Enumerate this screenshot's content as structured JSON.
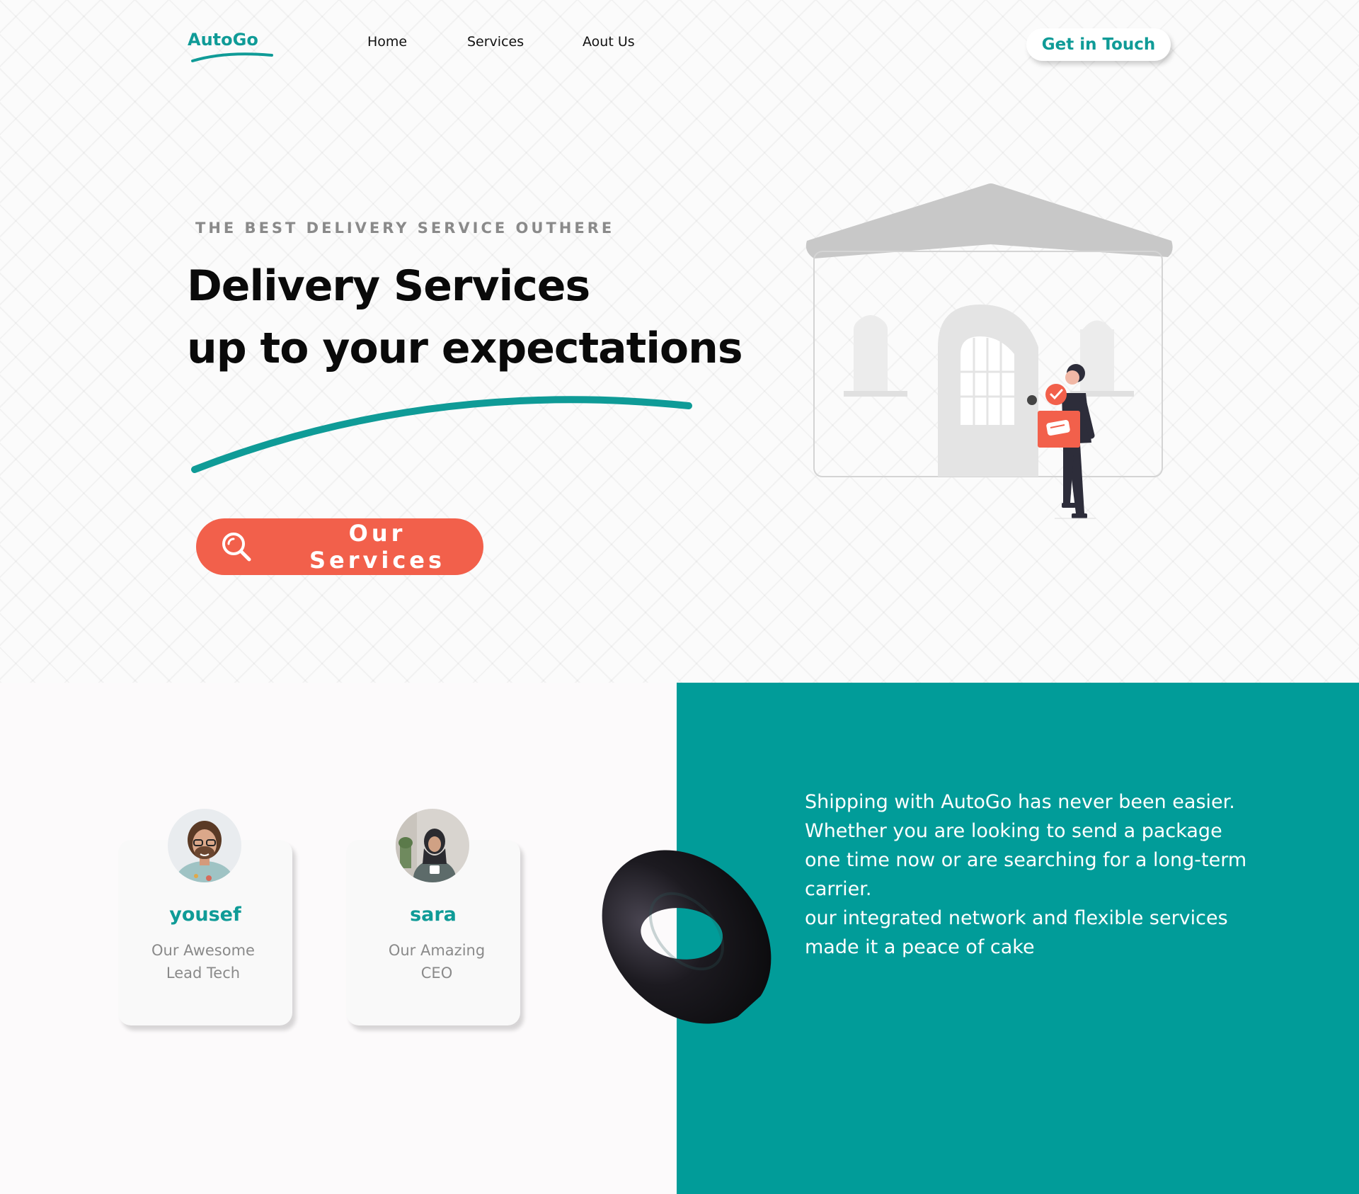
{
  "brand": {
    "name": "AutoGo",
    "accent": "#0f9b97",
    "cta_color": "#f2604b"
  },
  "nav": {
    "home": "Home",
    "services": "Services",
    "about": "Aout Us"
  },
  "header": {
    "cta_label": "Get in Touch"
  },
  "hero": {
    "tagline": "THE BEST DELIVERY SERVICE OUTHERE",
    "headline_line1": "Delivery Services",
    "headline_line2": "up to your expectations",
    "button_label": "Our Services",
    "button_icon": "search-icon"
  },
  "team": [
    {
      "name": "yousef",
      "role_line1": "Our Awesome",
      "role_line2": "Lead Tech"
    },
    {
      "name": "sara",
      "role_line1": "Our Amazing",
      "role_line2": "CEO"
    }
  ],
  "about": {
    "text": "Shipping with AutoGo has never been easier.\nWhether you are looking  to send a package\none time now or are searching for a long-term\ncarrier.\nour integrated network and flexible services\nmade it  a peace of cake"
  }
}
